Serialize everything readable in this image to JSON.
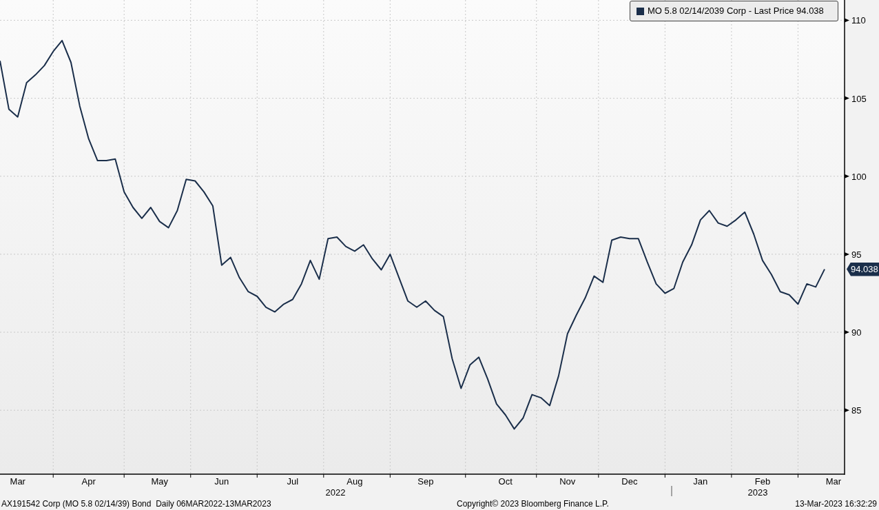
{
  "chart": {
    "legend": {
      "value": "94.038"
    },
    "last_price_tag": "94.038",
    "years": [
      "2022",
      "2023"
    ],
    "chart_data": {
      "type": "line",
      "grid": true,
      "ylim": [
        80.9,
        111.3
      ],
      "yticks": [
        85,
        90,
        95,
        100,
        105,
        110
      ],
      "categories": [
        null,
        null,
        "Mar",
        null,
        null,
        null,
        null,
        null,
        null,
        null,
        "Apr",
        null,
        null,
        null,
        null,
        null,
        null,
        null,
        "May",
        null,
        null,
        null,
        null,
        null,
        null,
        "Jun",
        null,
        null,
        null,
        null,
        null,
        null,
        null,
        "Jul",
        null,
        null,
        null,
        null,
        null,
        null,
        "Aug",
        null,
        null,
        null,
        null,
        null,
        null,
        null,
        "Sep",
        null,
        null,
        null,
        null,
        null,
        null,
        null,
        null,
        "Oct",
        null,
        null,
        null,
        null,
        null,
        null,
        "Nov",
        null,
        null,
        null,
        null,
        null,
        null,
        "Dec",
        null,
        null,
        null,
        null,
        null,
        null,
        null,
        "Jan",
        null,
        null,
        null,
        null,
        null,
        null,
        "Feb",
        null,
        null,
        null,
        null,
        null,
        null,
        null,
        "Mar",
        null
      ],
      "series": [
        {
          "name": "MO 5.8 02/14/2039 Corp - Last Price",
          "color": "#1a2e4a",
          "values": [
            107.4,
            104.3,
            103.8,
            106,
            106.5,
            107.1,
            108.0,
            108.7,
            107.3,
            104.5,
            102.4,
            101,
            101,
            101.1,
            99.0,
            98.0,
            97.3,
            98.0,
            97.1,
            96.7,
            97.8,
            99.8,
            99.7,
            99,
            98.1,
            94.3,
            94.8,
            93.5,
            92.6,
            92.3,
            91.6,
            91.3,
            91.8,
            92.1,
            93.1,
            94.6,
            93.4,
            96.0,
            96.1,
            95.5,
            95.2,
            95.6,
            94.7,
            94.0,
            95,
            93.5,
            92.0,
            91.6,
            92.0,
            91.4,
            91.0,
            88.3,
            86.4,
            87.9,
            88.4,
            87.0,
            85.4,
            84.7,
            83.8,
            84.5,
            86.0,
            85.8,
            85.3,
            87.2,
            89.9,
            91.1,
            92.2,
            93.6,
            93.2,
            95.9,
            96.1,
            96.0,
            96.0,
            94.5,
            93.1,
            92.5,
            92.8,
            94.5,
            95.6,
            97.2,
            97.8,
            97.0,
            96.8,
            97.2,
            97.7,
            96.3,
            94.6,
            93.7,
            92.6,
            92.4,
            91.8,
            93.1,
            92.9,
            94.04,
            null,
            null
          ]
        }
      ]
    }
  },
  "footer": {
    "security": "AX191542 Corp (MO 5.8 02/14/39) Bond  Daily 06MAR2022-13MAR2023",
    "copyright": "Copyright© 2023 Bloomberg Finance L.P.",
    "timestamp": "13-Mar-2023 16:32:29"
  }
}
